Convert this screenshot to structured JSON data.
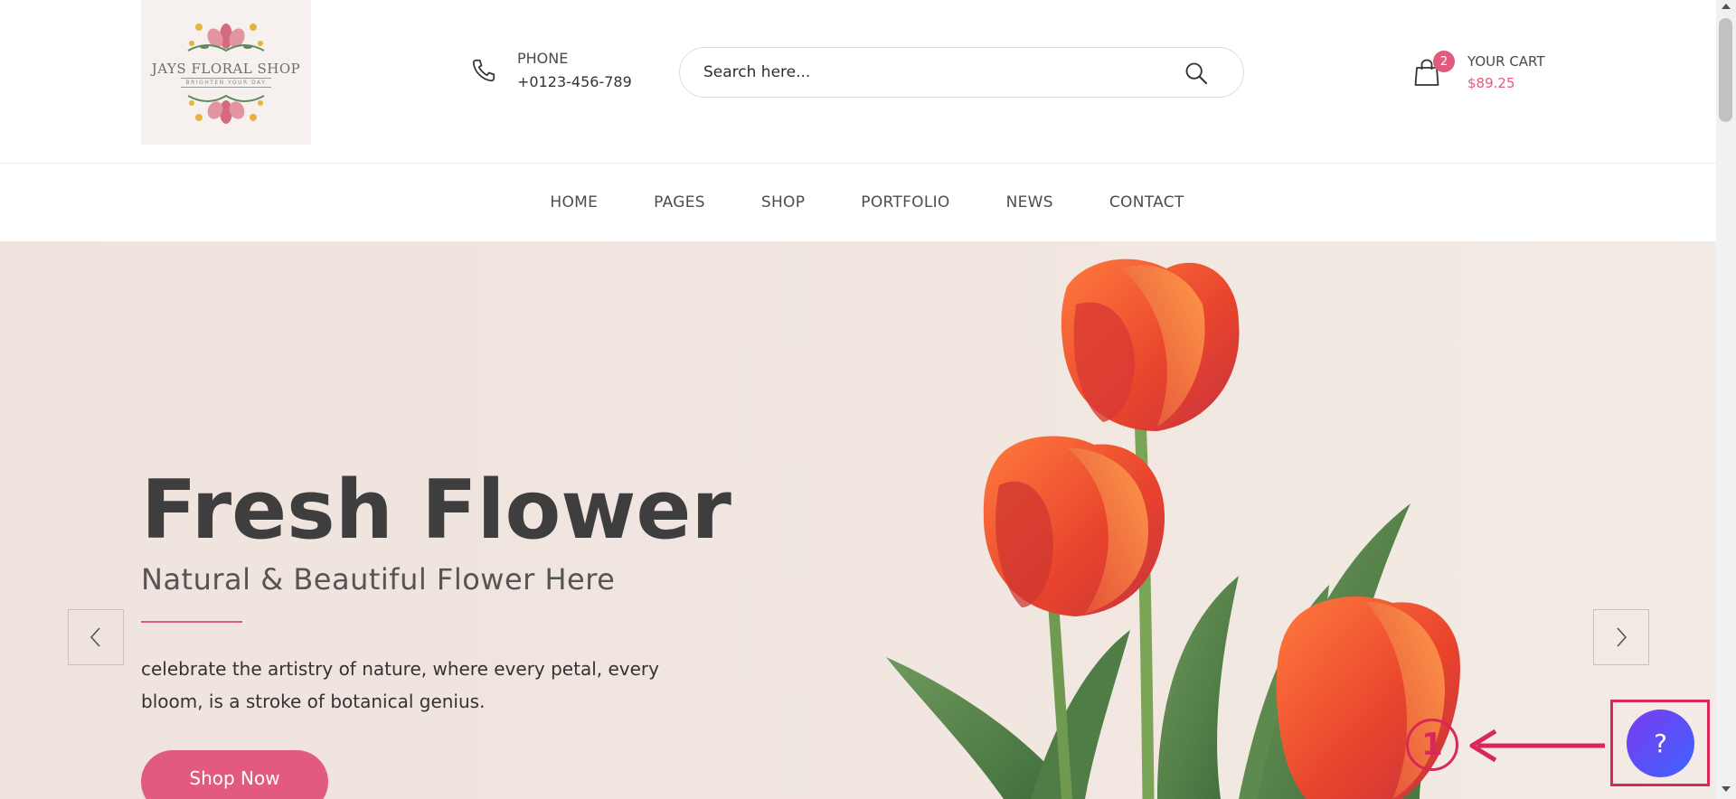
{
  "logo": {
    "title": "JAYS FLORAL SHOP",
    "tagline": "BRIGHTEN YOUR DAY"
  },
  "header": {
    "phone_label": "PHONE",
    "phone_number": "+0123-456-789",
    "search_placeholder": "Search here...",
    "cart_label": "YOUR CART",
    "cart_total": "$89.25",
    "cart_count": "2"
  },
  "nav": {
    "items": [
      {
        "label": "HOME"
      },
      {
        "label": "PAGES"
      },
      {
        "label": "SHOP"
      },
      {
        "label": "PORTFOLIO"
      },
      {
        "label": "NEWS"
      },
      {
        "label": "CONTACT"
      }
    ]
  },
  "hero": {
    "title": "Fresh Flower",
    "subtitle": "Natural & Beautiful Flower Here",
    "description": "celebrate the artistry of nature, where every petal, every bloom, is a stroke of botanical genius.",
    "cta_label": "Shop Now"
  },
  "help": {
    "label": "?"
  },
  "annotation": {
    "number": "1"
  },
  "colors": {
    "accent": "#e25a7d",
    "annotation": "#d8285a",
    "help_gradient_start": "#7a3cf0",
    "help_gradient_end": "#3e62ff"
  },
  "icons": {
    "phone": "phone-icon",
    "search": "search-icon",
    "cart": "shopping-bag-icon",
    "prev": "chevron-left-icon",
    "next": "chevron-right-icon"
  }
}
